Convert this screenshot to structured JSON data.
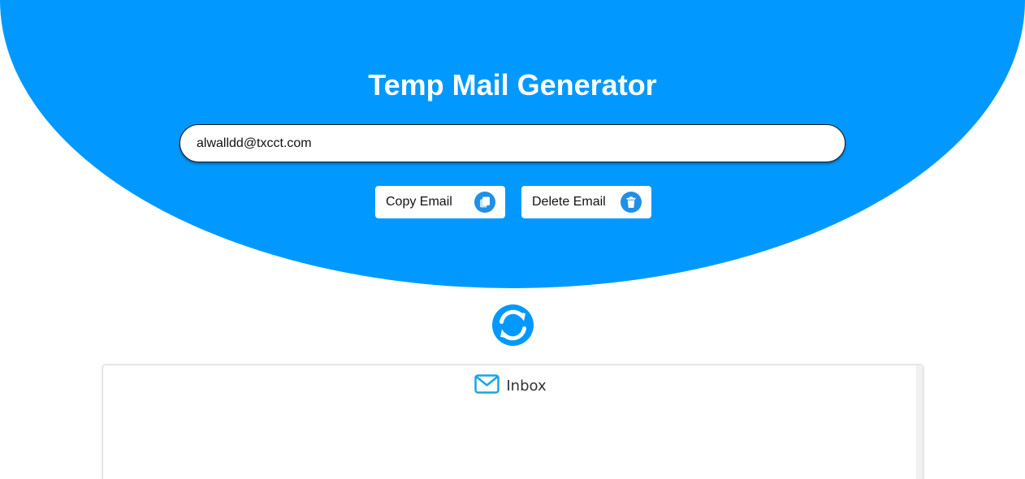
{
  "header": {
    "title": "Temp Mail Generator"
  },
  "email": {
    "value": "alwalldd@txcct.com"
  },
  "actions": {
    "copy_label": "Copy Email",
    "delete_label": "Delete Email"
  },
  "inbox": {
    "label": "Inbox"
  },
  "icons": {
    "copy": "copy-icon",
    "delete": "trash-icon",
    "refresh": "refresh-icon",
    "inbox": "envelope-icon"
  },
  "colors": {
    "brand_blue": "#0199ff",
    "icon_blue": "#1f8fe8",
    "envelope_blue": "#1ca3e6"
  }
}
